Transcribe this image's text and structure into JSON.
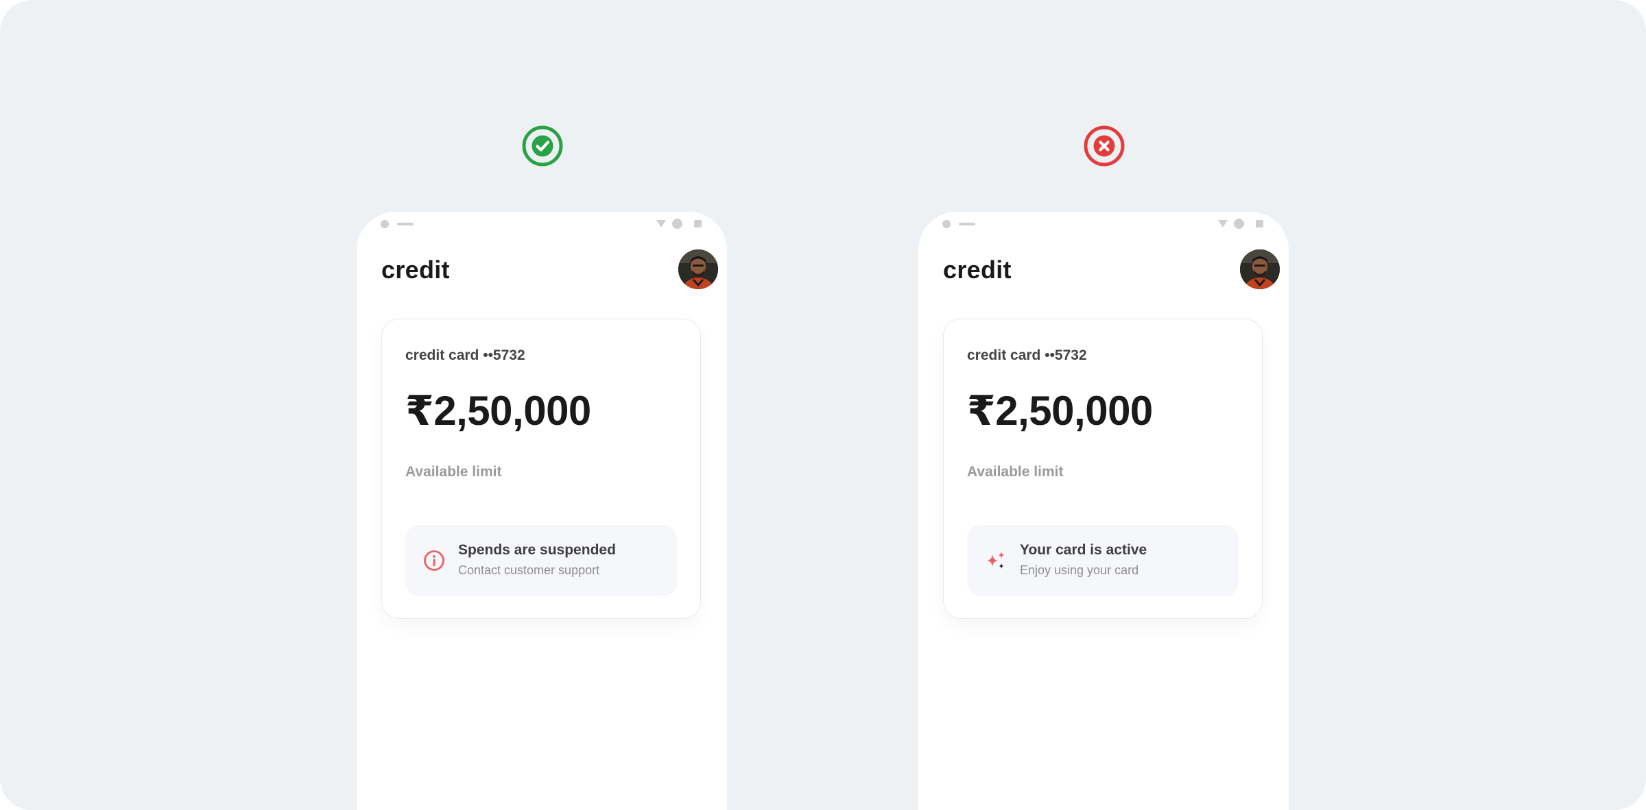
{
  "comparison": {
    "good_verdict_icon": "check-circle-icon",
    "bad_verdict_icon": "x-circle-icon",
    "good_color": "#27a244",
    "bad_color": "#e23c3c"
  },
  "good_example": {
    "app_title": "credit",
    "card_name": "credit card ••5732",
    "amount": "₹2,50,000",
    "amount_label": "Available limit",
    "notice": {
      "icon": "info-circle-icon",
      "icon_color": "#ec6262",
      "title": "Spends are suspended",
      "subtitle": "Contact customer support"
    }
  },
  "bad_example": {
    "app_title": "credit",
    "card_name": "credit card ••5732",
    "amount": "₹2,50,000",
    "amount_label": "Available limit",
    "notice": {
      "icon": "sparkles-icon",
      "icon_color": "#ec6262",
      "title": "Your card is active",
      "subtitle": "Enjoy using your card"
    }
  }
}
